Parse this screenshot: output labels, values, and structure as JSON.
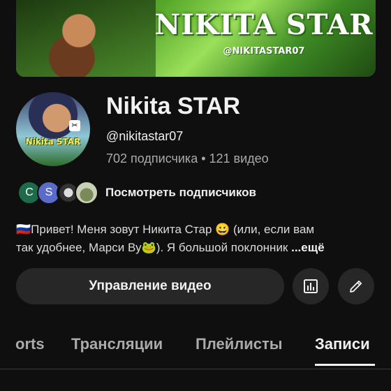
{
  "banner": {
    "title": "NIKITA STAR",
    "handle": "@NIKITASTAR07"
  },
  "avatar": {
    "label": "Nikita STAR",
    "badge": "✂"
  },
  "channel": {
    "name": "Nikita STAR",
    "handle": "@nikitastar07",
    "stats": "702 подписчика • 121 видео"
  },
  "subscribers": {
    "avatars": [
      "C",
      "S",
      "",
      ""
    ],
    "label": "Посмотреть подписчиков"
  },
  "description": {
    "line1": "🇷🇺Привет! Меня зовут Никита Стар 😀 (или, если вам",
    "line2": "так удобнее, Марси Ву🐸). Я большой поклонник",
    "more": "...ещё"
  },
  "actions": {
    "manage_label": "Управление видео",
    "stats_icon": "bar-chart-icon",
    "edit_icon": "pencil-icon"
  },
  "tabs": [
    {
      "label": "orts"
    },
    {
      "label": "Трансляции"
    },
    {
      "label": "Плейлисты"
    },
    {
      "label": "Записи",
      "active": true
    }
  ],
  "colors": {
    "background": "#0f0f0f",
    "button_bg": "#272727",
    "text_primary": "#f1f1f1",
    "text_secondary": "#aaaaaa"
  }
}
